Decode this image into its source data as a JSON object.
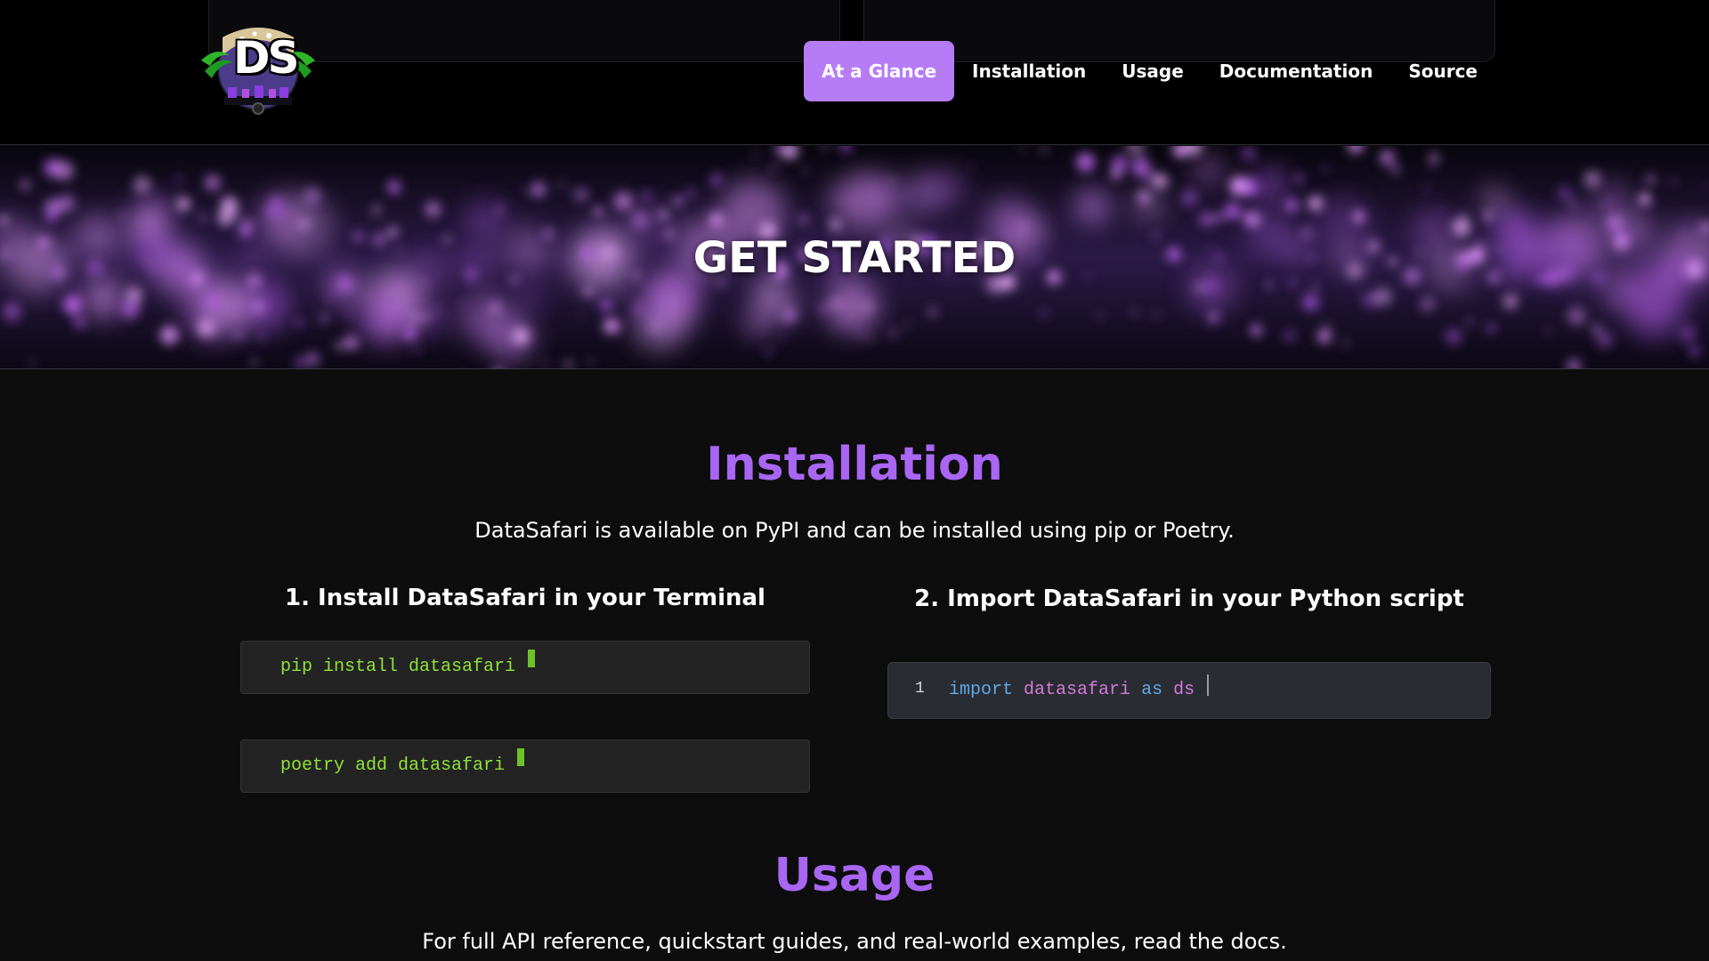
{
  "brand": {
    "logo_text": "DS",
    "logo_icon": "palm-tree-globe-logo"
  },
  "nav": {
    "items": [
      {
        "label": "At a Glance",
        "active": true
      },
      {
        "label": "Installation",
        "active": false
      },
      {
        "label": "Usage",
        "active": false
      },
      {
        "label": "Documentation",
        "active": false
      },
      {
        "label": "Source",
        "active": false
      }
    ]
  },
  "hero": {
    "title": "GET STARTED"
  },
  "installation": {
    "title": "Installation",
    "subtitle": "DataSafari is available on PyPI and can be installed using pip or Poetry.",
    "step1": {
      "title": "1. Install DataSafari in your Terminal",
      "commands": [
        "pip install datasafari",
        "poetry add datasafari"
      ]
    },
    "step2": {
      "title": "2. Import DataSafari in your Python script",
      "line_number": "1",
      "code": {
        "kw1": "import",
        "module": "datasafari",
        "kw2": "as",
        "alias": "ds"
      }
    }
  },
  "usage": {
    "title": "Usage",
    "subtitle": "For full API reference, quickstart guides, and real-world examples, read the docs."
  },
  "colors": {
    "accent": "#a866f3",
    "nav_active": "#b67cf5",
    "terminal_text": "#8fe23a",
    "code_keyword": "#60a8e6",
    "code_module": "#d27ad9"
  }
}
